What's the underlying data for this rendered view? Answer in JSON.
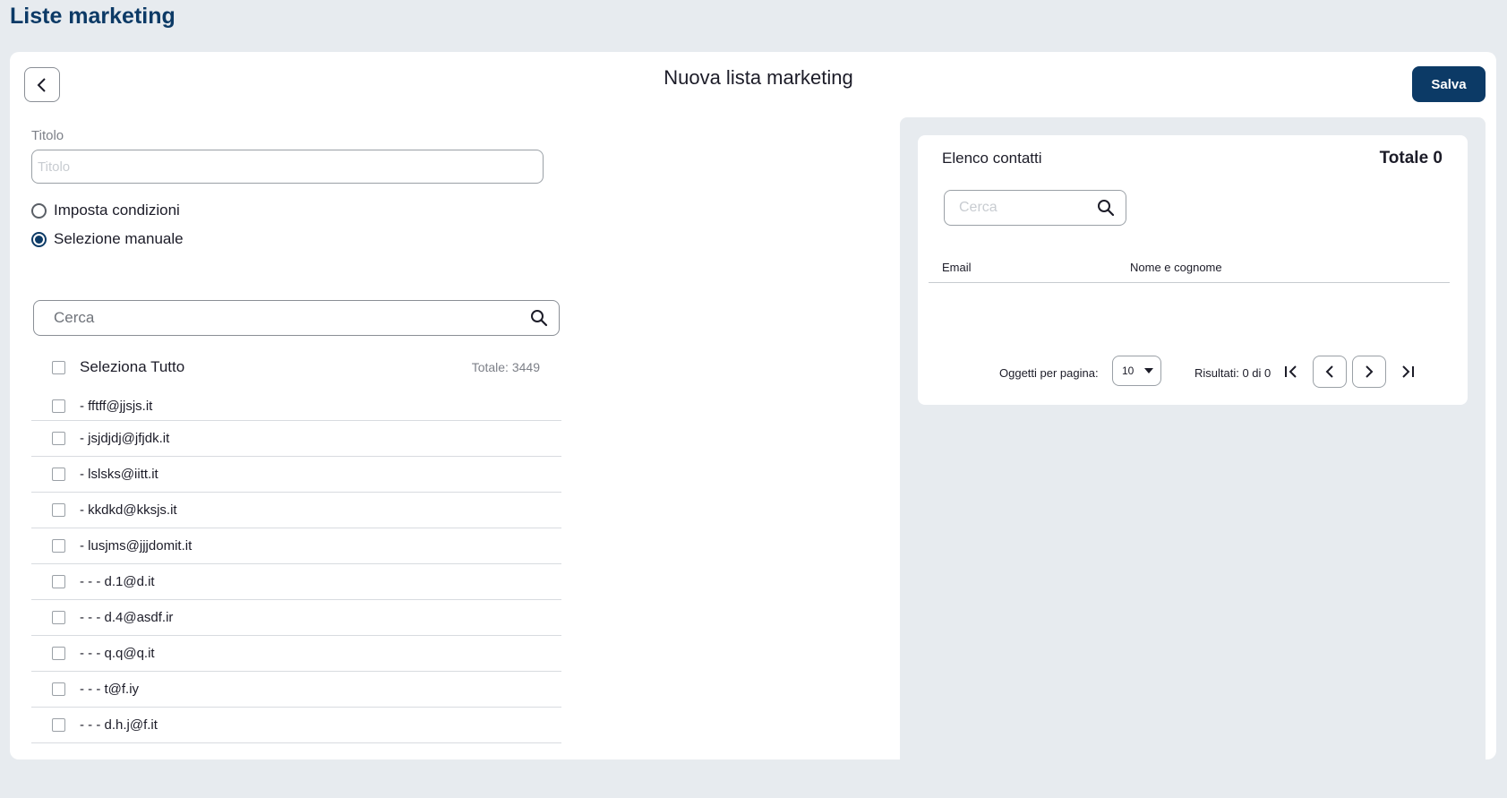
{
  "header": {
    "title": "Liste marketing"
  },
  "form": {
    "title": "Nuova lista marketing",
    "save_label": "Salva",
    "title_field": {
      "label": "Titolo",
      "placeholder": "Titolo",
      "value": ""
    },
    "mode_options": [
      {
        "label": "Imposta condizioni",
        "selected": false
      },
      {
        "label": "Selezione manuale",
        "selected": true
      }
    ],
    "search": {
      "placeholder": "Cerca",
      "value": ""
    },
    "select_all": {
      "label": "Seleziona Tutto",
      "total": "Totale: 3449",
      "checked": false
    },
    "contacts": [
      {
        "label": "- fftff@jjsjs.it",
        "checked": false
      },
      {
        "label": "- jsjdjdj@jfjdk.it",
        "checked": false
      },
      {
        "label": "- lslsks@iitt.it",
        "checked": false
      },
      {
        "label": "- kkdkd@kksjs.it",
        "checked": false
      },
      {
        "label": "- lusjms@jjjdomit.it",
        "checked": false
      },
      {
        "label": "- - - d.1@d.it",
        "checked": false
      },
      {
        "label": "- - - d.4@asdf.ir",
        "checked": false
      },
      {
        "label": "- - - q.q@q.it",
        "checked": false
      },
      {
        "label": "- - - t@f.iy",
        "checked": false
      },
      {
        "label": "- - - d.h.j@f.it",
        "checked": false
      }
    ]
  },
  "contacts_panel": {
    "title": "Elenco contatti",
    "total": "Totale 0",
    "search": {
      "placeholder": "Cerca",
      "value": ""
    },
    "columns": [
      "Email",
      "Nome e cognome"
    ],
    "rows": [],
    "pagination": {
      "items_per_page_label": "Oggetti per pagina:",
      "items_per_page": "10",
      "results": "Risultati: 0 di 0"
    }
  },
  "icons": {
    "back": "chevron-left-icon",
    "search": "search-icon",
    "first": "first-page-icon",
    "prev": "chevron-left-icon",
    "next": "chevron-right-icon",
    "last": "last-page-icon"
  },
  "colors": {
    "brand": "#0c3a66",
    "background": "#e7ebef"
  }
}
